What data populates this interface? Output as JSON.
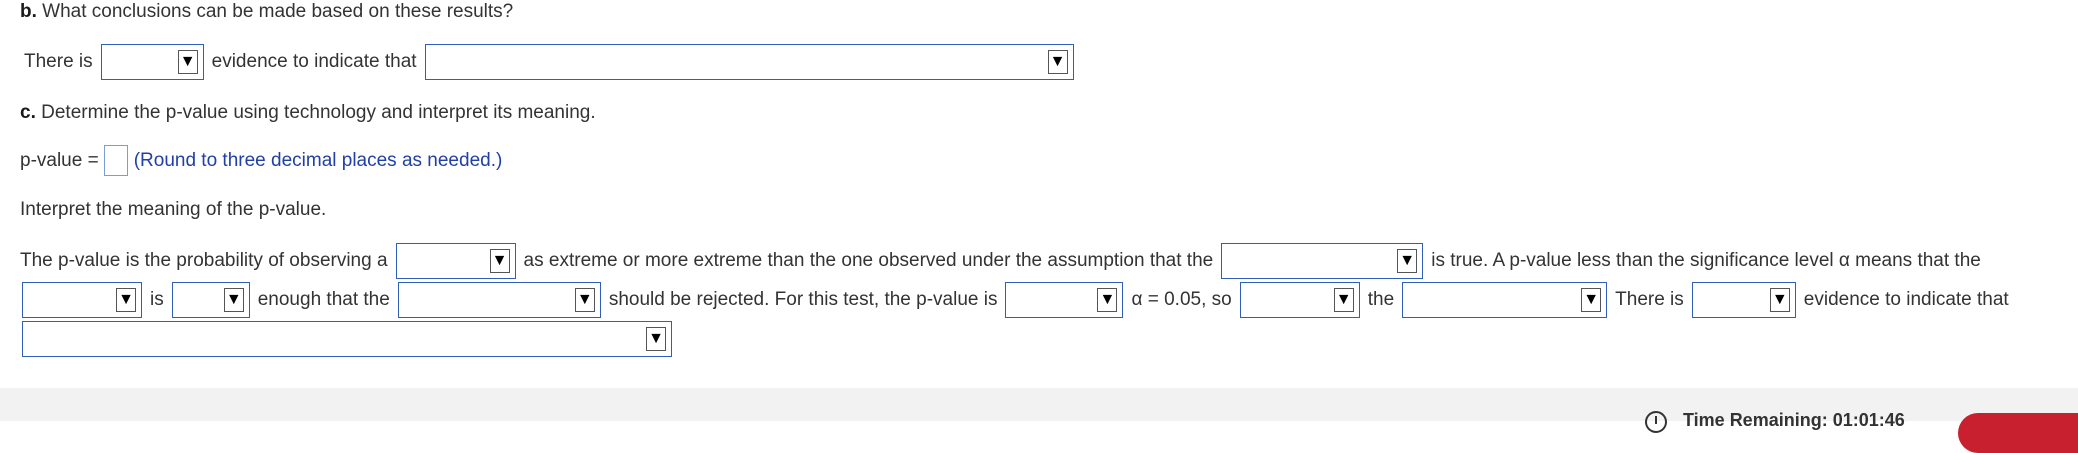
{
  "part_b": {
    "letter": "b.",
    "question": "What conclusions can be made based on these results?",
    "line1_pre": "There is",
    "line1_mid": "evidence to indicate that"
  },
  "part_c": {
    "letter": "c.",
    "question": "Determine the p-value using technology and interpret its meaning.",
    "pvalue_label": "p-value =",
    "pvalue_hint": "(Round to three decimal places as needed.)",
    "interpret_prompt": "Interpret the meaning of the p-value.",
    "s1": "The p-value is the probability of observing a",
    "s2": "as extreme or more extreme than the one observed under the assumption that the",
    "s3": "is true. A p-value less than the significance level α means that the",
    "s4": "is",
    "s5": "enough that the",
    "s6": "should be rejected. For this test, the p-value is",
    "s7": "α = 0.05, so",
    "s8": "the",
    "s9": "There is",
    "s10": "evidence to indicate that"
  },
  "footer": {
    "time_label": "Time Remaining: 01:01:46"
  },
  "icons": {
    "dropdown": "dropdown-arrow-icon",
    "clock": "clock-icon"
  }
}
